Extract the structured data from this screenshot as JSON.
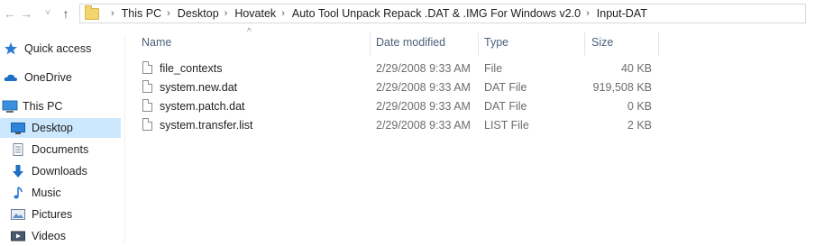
{
  "nav": {
    "back_glyph": "←",
    "forward_glyph": "→",
    "up_glyph": "↑",
    "breadcrumb": [
      "This PC",
      "Desktop",
      "Hovatek",
      "Auto Tool Unpack Repack .DAT & .IMG For Windows v2.0",
      "Input-DAT"
    ]
  },
  "sidebar": {
    "items": [
      {
        "label": "Quick access",
        "icon": "star-icon"
      },
      {
        "label": "OneDrive",
        "icon": "cloud-icon"
      },
      {
        "label": "This PC",
        "icon": "computer-icon"
      },
      {
        "label": "Desktop",
        "icon": "desktop-icon",
        "selected": true
      },
      {
        "label": "Documents",
        "icon": "documents-icon"
      },
      {
        "label": "Downloads",
        "icon": "download-icon"
      },
      {
        "label": "Music",
        "icon": "music-icon"
      },
      {
        "label": "Pictures",
        "icon": "pictures-icon"
      },
      {
        "label": "Videos",
        "icon": "videos-icon"
      }
    ]
  },
  "columns": {
    "name": "Name",
    "date": "Date modified",
    "type": "Type",
    "size": "Size",
    "sort_glyph": "^"
  },
  "files": [
    {
      "name": "file_contexts",
      "date": "2/29/2008 9:33 AM",
      "type": "File",
      "size": "40 KB"
    },
    {
      "name": "system.new.dat",
      "date": "2/29/2008 9:33 AM",
      "type": "DAT File",
      "size": "919,508 KB"
    },
    {
      "name": "system.patch.dat",
      "date": "2/29/2008 9:33 AM",
      "type": "DAT File",
      "size": "0 KB"
    },
    {
      "name": "system.transfer.list",
      "date": "2/29/2008 9:33 AM",
      "type": "LIST File",
      "size": "2 KB"
    }
  ],
  "colors": {
    "selection": "#cce8ff",
    "header_text": "#4c607a"
  }
}
